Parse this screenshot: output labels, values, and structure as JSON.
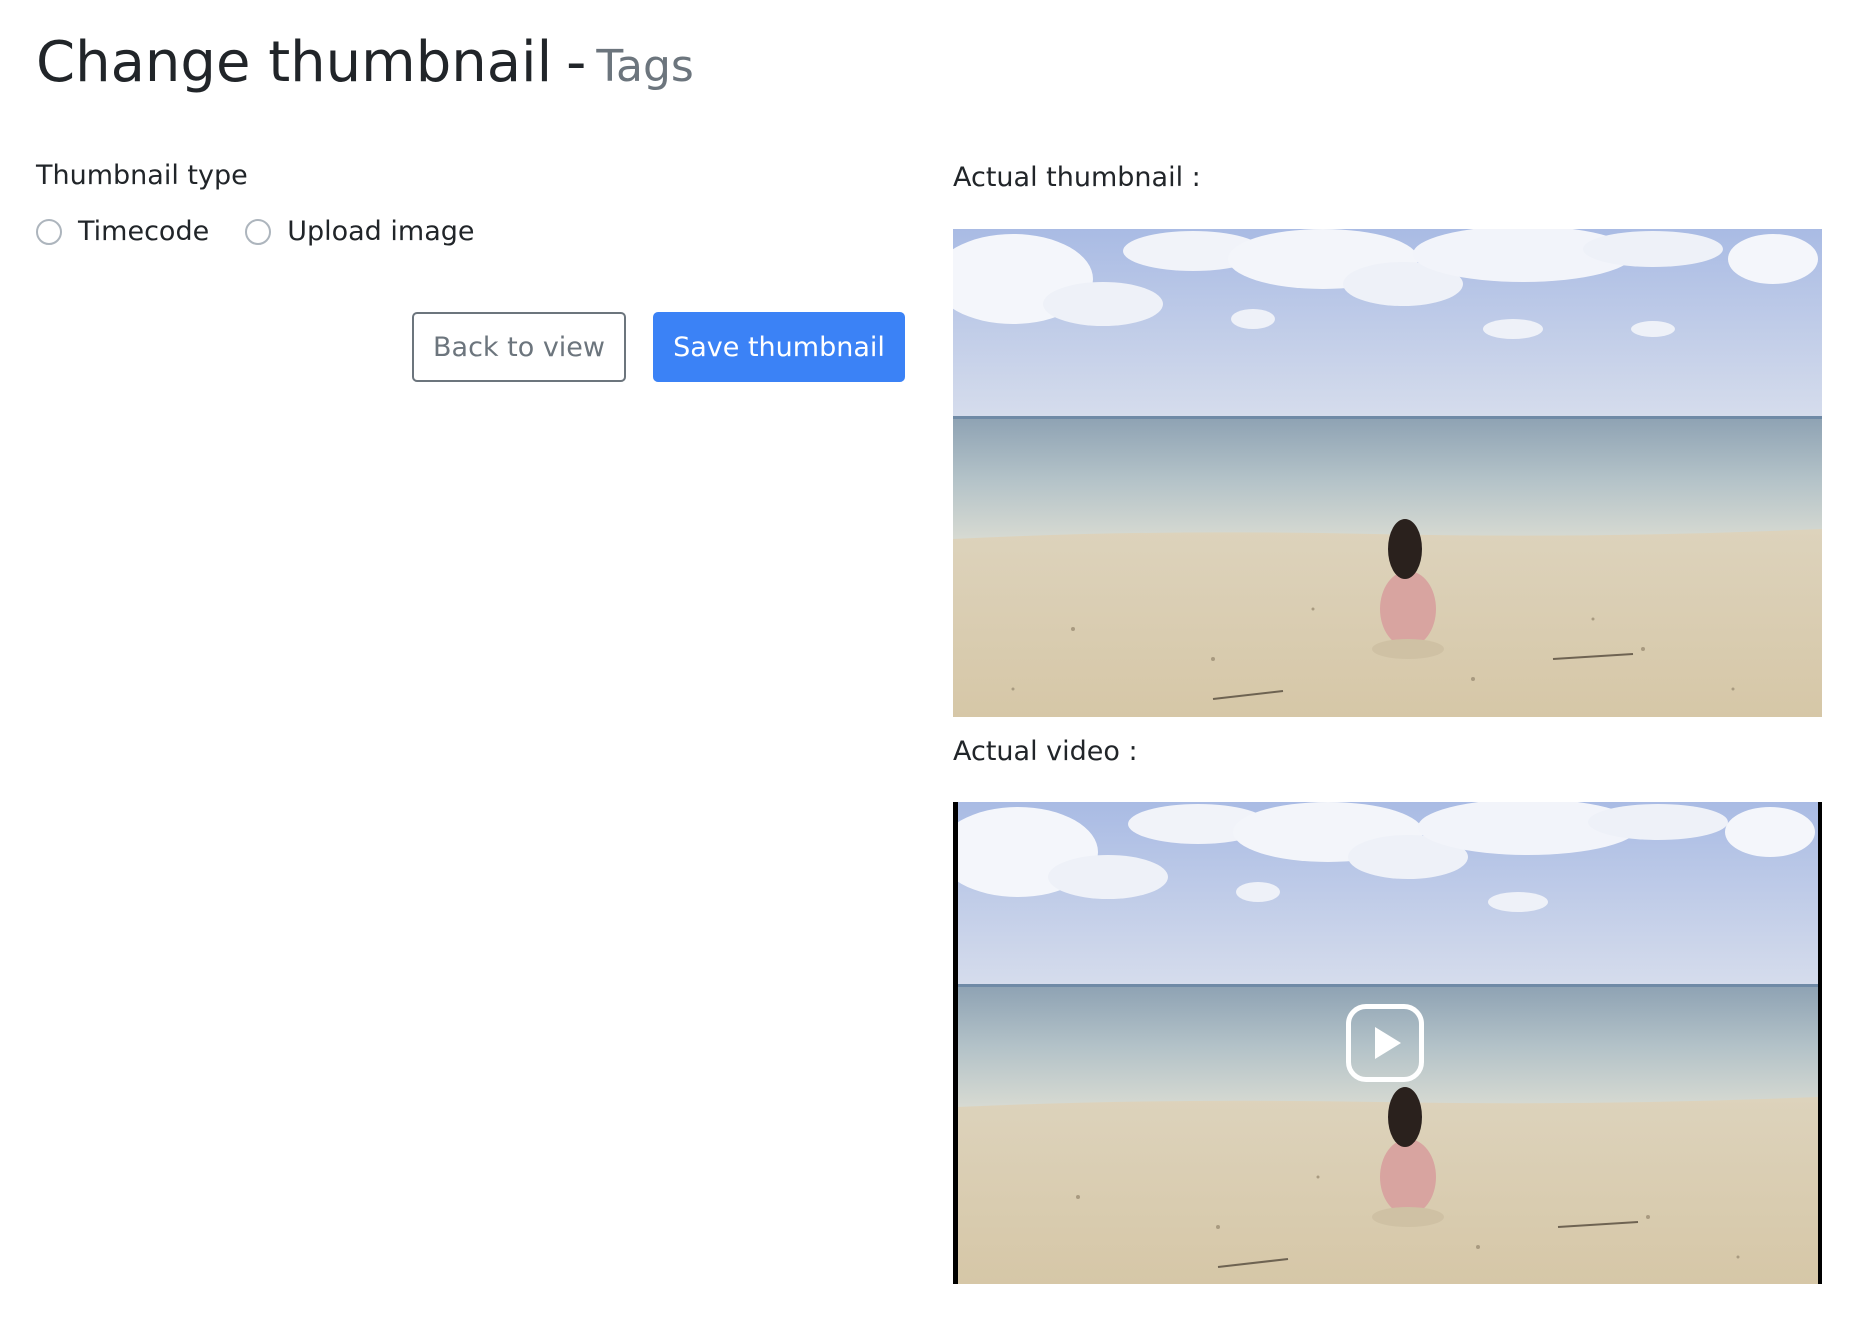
{
  "header": {
    "title": "Change thumbnail",
    "separator": "-",
    "subtitle": "Tags"
  },
  "form": {
    "thumbnail_type_label": "Thumbnail type",
    "options": [
      {
        "label": "Timecode",
        "selected": false
      },
      {
        "label": "Upload image",
        "selected": false
      }
    ],
    "back_button": "Back to view",
    "save_button": "Save thumbnail"
  },
  "preview": {
    "thumbnail_label": "Actual thumbnail :",
    "video_label": "Actual video :",
    "play_icon": "play-icon"
  },
  "colors": {
    "primary": "#3b82f6",
    "secondary": "#6c757d",
    "text": "#212529"
  }
}
